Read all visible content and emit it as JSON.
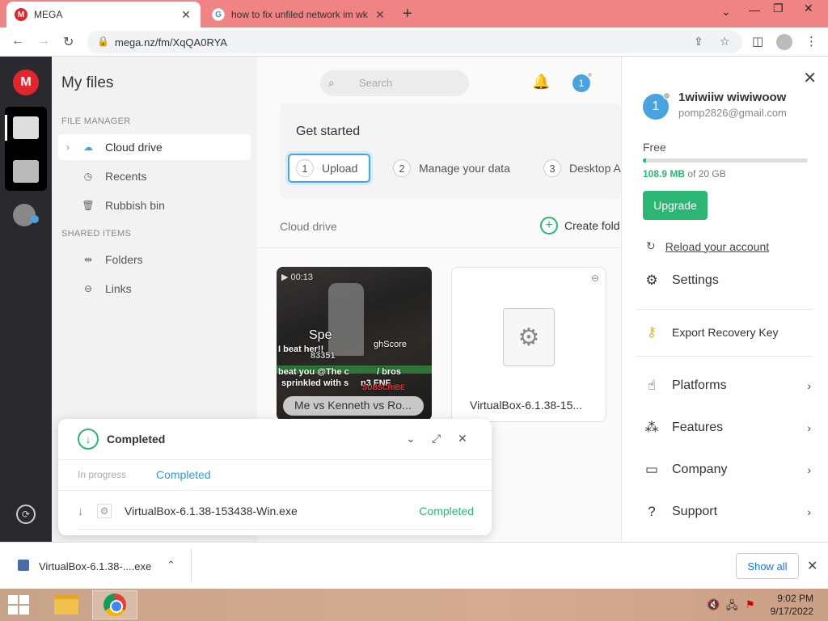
{
  "browser": {
    "tabs": [
      {
        "title": "MEGA",
        "favicon": "M",
        "active": true
      },
      {
        "title": "how to fix unfiled network im wk",
        "favicon": "G",
        "active": false
      }
    ],
    "url": "mega.nz/fm/XqQA0RYA"
  },
  "sidebar": {
    "title": "My files",
    "section_file_manager": "FILE MANAGER",
    "items": [
      {
        "label": "Cloud drive",
        "icon": "cloud-icon",
        "selected": true
      },
      {
        "label": "Recents",
        "icon": "clock-icon"
      },
      {
        "label": "Rubbish bin",
        "icon": "trash-icon"
      }
    ],
    "section_shared": "SHARED ITEMS",
    "shared_items": [
      {
        "label": "Folders",
        "icon": "shared-folder-icon"
      },
      {
        "label": "Links",
        "icon": "link-icon"
      }
    ]
  },
  "topbar": {
    "search_placeholder": "Search",
    "avatar_initial": "1"
  },
  "get_started": {
    "title": "Get started",
    "steps": [
      {
        "num": "1",
        "label": "Upload"
      },
      {
        "num": "2",
        "label": "Manage your data"
      },
      {
        "num": "3",
        "label": "Desktop A"
      }
    ]
  },
  "content": {
    "breadcrumb": "Cloud drive",
    "create_folder": "Create fold",
    "files": [
      {
        "name": "Me vs Kenneth vs Ro...",
        "duration": "00:13",
        "overlay_lines": [
          "Spe",
          "ghScore",
          "I beat her!!",
          "83351",
          "beat you @The c",
          "/ bros",
          "sprinkled with s",
          "n3 FNF",
          "SUBSCRIBE"
        ],
        "type": "video"
      },
      {
        "name": "VirtualBox-6.1.38-15...",
        "type": "exe"
      }
    ]
  },
  "transfer": {
    "title": "Completed",
    "tab_in_progress": "In progress",
    "tab_completed": "Completed",
    "item_name": "VirtualBox-6.1.38-153438-Win.exe",
    "item_status": "Completed"
  },
  "account": {
    "name": "1wiwiiw wiwiwoow",
    "email": "pomp2826@gmail.com",
    "avatar_initial": "1",
    "plan": "Free",
    "storage_used": "108.9 MB",
    "storage_of": "of 20 GB",
    "storage_fraction": 0.005,
    "upgrade": "Upgrade",
    "reload": "Reload your account",
    "settings": "Settings",
    "export_key": "Export Recovery Key",
    "menu": [
      "Platforms",
      "Features",
      "Company",
      "Support"
    ]
  },
  "download_shelf": {
    "filename": "VirtualBox-6.1.38-....exe",
    "show_all": "Show all"
  },
  "taskbar": {
    "time": "9:02 PM",
    "date": "9/17/2022"
  },
  "colors": {
    "mega_red": "#e0262e",
    "accent_green": "#2bb673",
    "accent_blue": "#4aa3df",
    "tabbar": "#f08384"
  }
}
